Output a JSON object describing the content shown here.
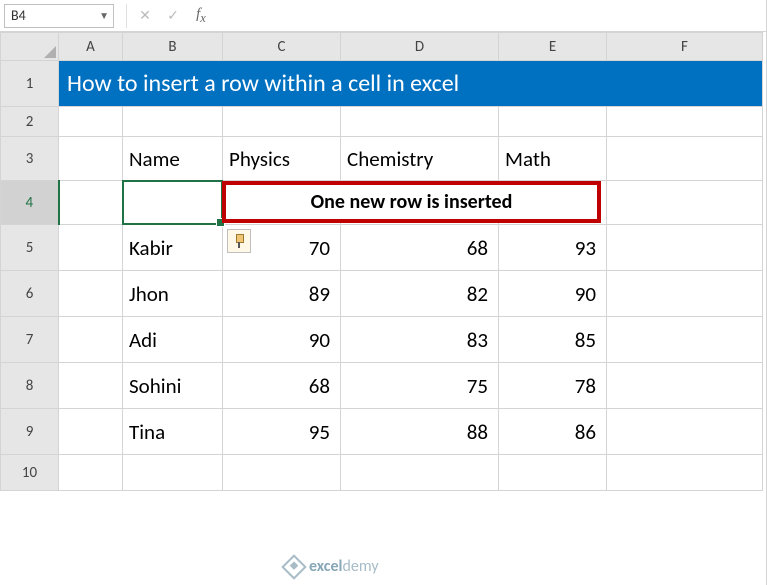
{
  "namebox": "B4",
  "title": "How to insert a row within a cell in excel",
  "headers": {
    "name": "Name",
    "physics": "Physics",
    "chemistry": "Chemistry",
    "math": "Math"
  },
  "callout": "One new row is inserted",
  "rows": [
    {
      "name": "Kabir",
      "physics": 70,
      "chemistry": 68,
      "math": 93
    },
    {
      "name": "Jhon",
      "physics": 89,
      "chemistry": 82,
      "math": 90
    },
    {
      "name": "Adi",
      "physics": 90,
      "chemistry": 83,
      "math": 85
    },
    {
      "name": "Sohini",
      "physics": 68,
      "chemistry": 75,
      "math": 78
    },
    {
      "name": "Tina",
      "physics": 95,
      "chemistry": 88,
      "math": 86
    }
  ],
  "cols": [
    "A",
    "B",
    "C",
    "D",
    "E",
    "F"
  ],
  "rownums": [
    "1",
    "2",
    "3",
    "4",
    "5",
    "6",
    "7",
    "8",
    "9",
    "10"
  ],
  "watermark": {
    "brand": "excel",
    "suffix": "demy"
  },
  "chart_data": {
    "type": "table",
    "title": "How to insert a row within a cell in excel",
    "columns": [
      "Name",
      "Physics",
      "Chemistry",
      "Math"
    ],
    "rows": [
      [
        "Kabir",
        70,
        68,
        93
      ],
      [
        "Jhon",
        89,
        82,
        90
      ],
      [
        "Adi",
        90,
        83,
        85
      ],
      [
        "Sohini",
        68,
        75,
        78
      ],
      [
        "Tina",
        95,
        88,
        86
      ]
    ]
  }
}
